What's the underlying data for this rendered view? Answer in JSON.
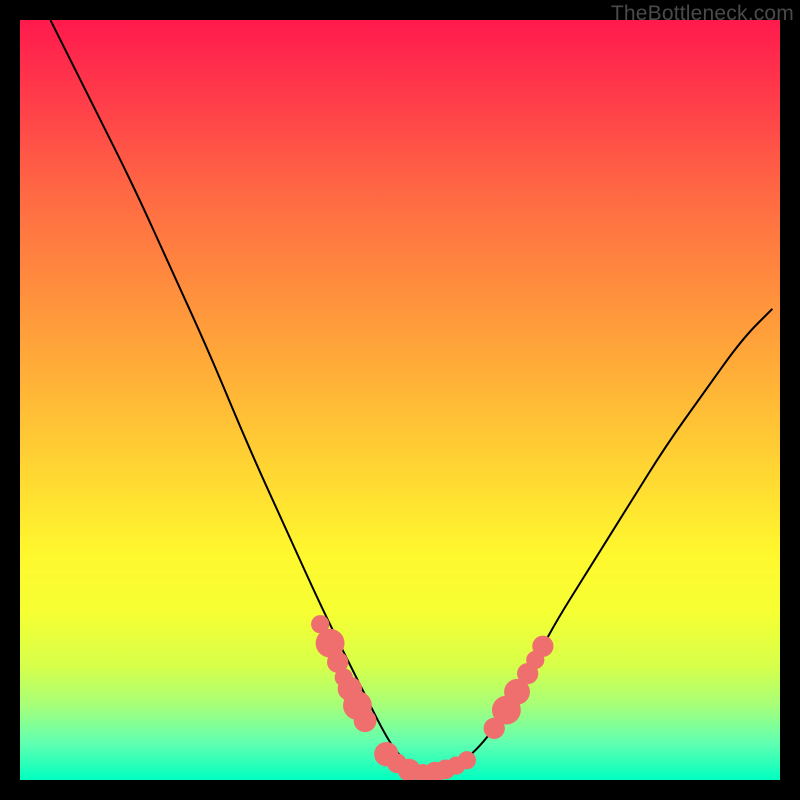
{
  "watermark": "TheBottleneck.com",
  "chart_data": {
    "type": "line",
    "title": "",
    "xlabel": "",
    "ylabel": "",
    "xlim": [
      0,
      100
    ],
    "ylim": [
      0,
      100
    ],
    "series": [
      {
        "name": "curve",
        "x": [
          4,
          10,
          15,
          20,
          25,
          30,
          35,
          40,
          45,
          48,
          50,
          53,
          55,
          58,
          62,
          67,
          70,
          75,
          80,
          85,
          90,
          95,
          99
        ],
        "y": [
          100,
          88,
          78,
          67,
          56,
          44,
          33,
          22,
          12,
          6,
          3,
          1,
          1,
          2,
          6,
          14,
          20,
          28,
          36,
          44,
          51,
          58,
          62
        ]
      }
    ],
    "markers": [
      {
        "x": 39.5,
        "y": 20.5,
        "r": 1.2
      },
      {
        "x": 40.8,
        "y": 18.0,
        "r": 1.9
      },
      {
        "x": 41.8,
        "y": 15.5,
        "r": 1.4
      },
      {
        "x": 42.6,
        "y": 13.5,
        "r": 1.2
      },
      {
        "x": 43.4,
        "y": 12.0,
        "r": 1.6
      },
      {
        "x": 44.4,
        "y": 9.8,
        "r": 1.9
      },
      {
        "x": 45.4,
        "y": 7.8,
        "r": 1.5
      },
      {
        "x": 48.2,
        "y": 3.4,
        "r": 1.6
      },
      {
        "x": 49.6,
        "y": 2.2,
        "r": 1.3
      },
      {
        "x": 51.2,
        "y": 1.3,
        "r": 1.5
      },
      {
        "x": 53.0,
        "y": 0.9,
        "r": 1.2
      },
      {
        "x": 54.6,
        "y": 1.0,
        "r": 1.4
      },
      {
        "x": 56.0,
        "y": 1.4,
        "r": 1.3
      },
      {
        "x": 57.4,
        "y": 1.9,
        "r": 1.2
      },
      {
        "x": 58.8,
        "y": 2.6,
        "r": 1.2
      },
      {
        "x": 62.4,
        "y": 6.8,
        "r": 1.4
      },
      {
        "x": 64.0,
        "y": 9.2,
        "r": 1.9
      },
      {
        "x": 65.4,
        "y": 11.6,
        "r": 1.7
      },
      {
        "x": 66.8,
        "y": 14.0,
        "r": 1.4
      },
      {
        "x": 67.8,
        "y": 15.8,
        "r": 1.2
      },
      {
        "x": 68.8,
        "y": 17.6,
        "r": 1.4
      }
    ],
    "colors": {
      "curve": "#000000",
      "marker": "#ef6f6e"
    }
  }
}
